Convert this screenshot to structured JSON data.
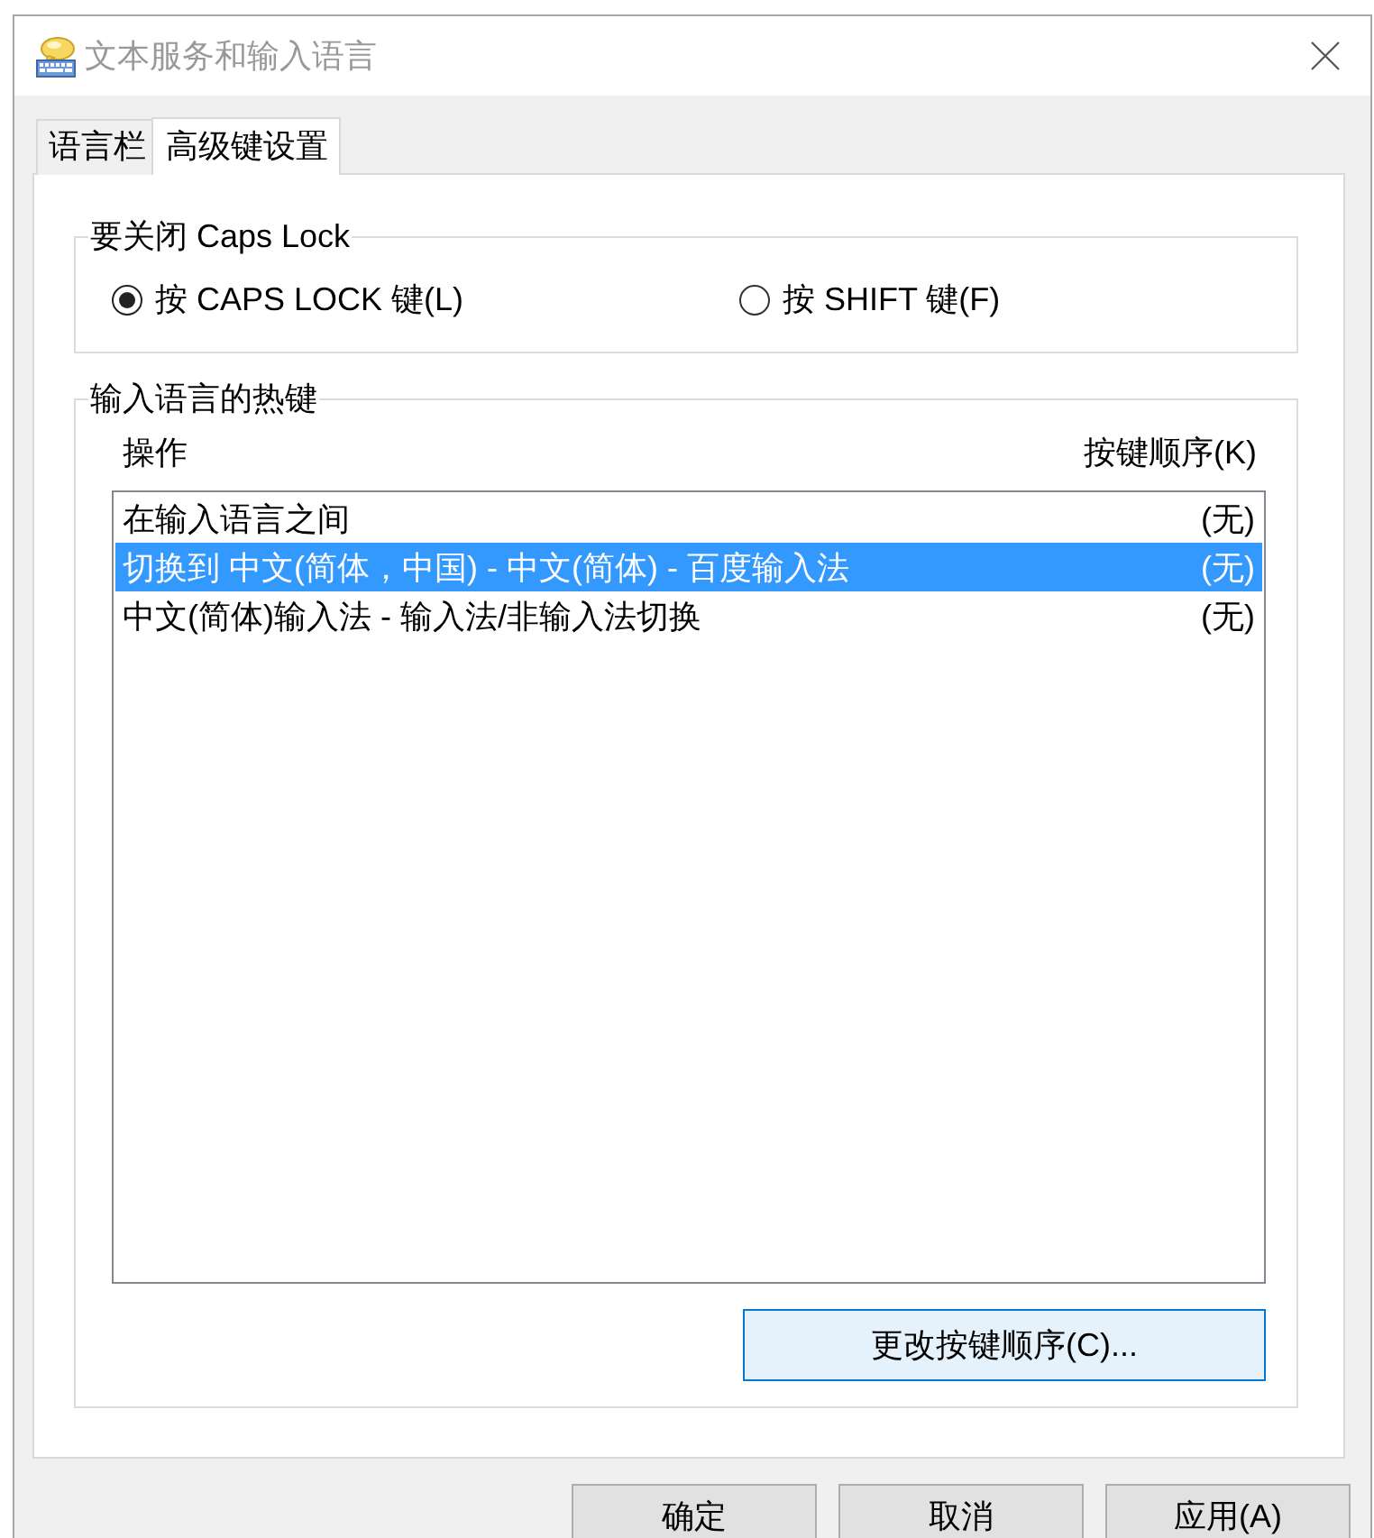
{
  "window": {
    "title": "文本服务和输入语言"
  },
  "tabs": [
    {
      "label": "语言栏",
      "selected": false
    },
    {
      "label": "高级键设置",
      "selected": true
    }
  ],
  "caps_lock_group": {
    "title": "要关闭 Caps Lock",
    "options": [
      {
        "label": "按 CAPS LOCK 键(L)",
        "selected": true
      },
      {
        "label": "按 SHIFT 键(F)",
        "selected": false
      }
    ]
  },
  "hotkeys_group": {
    "title": "输入语言的热键",
    "columns": [
      "操作",
      "按键顺序(K)"
    ],
    "rows": [
      {
        "action": "在输入语言之间",
        "key_sequence": "(无)",
        "selected": false
      },
      {
        "action": "切换到 中文(简体，中国) - 中文(简体) - 百度输入法",
        "key_sequence": "(无)",
        "selected": true
      },
      {
        "action": "中文(简体)输入法 - 输入法/非输入法切换",
        "key_sequence": "(无)",
        "selected": false
      }
    ],
    "change_button": {
      "label": "更改按键顺序(C)...",
      "focused": true
    }
  },
  "buttons": [
    "确定",
    "取消",
    "应用(A)"
  ]
}
